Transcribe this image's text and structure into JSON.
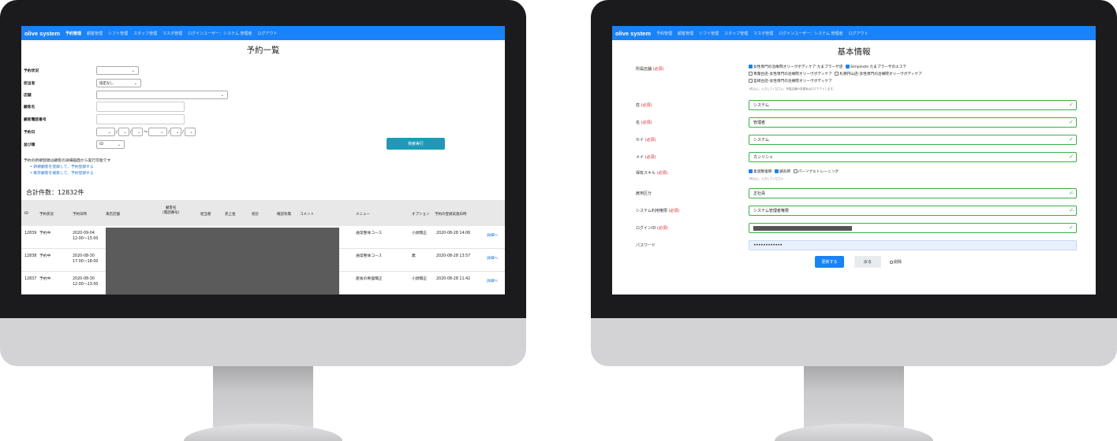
{
  "left": {
    "nav": {
      "brand": "olive system",
      "items": [
        "予約管理",
        "顧客管理",
        "シフト管理",
        "スタッフ管理",
        "マスタ管理",
        "ログインユーザー：システム 管理者",
        "ログアウト"
      ]
    },
    "title": "予約一覧",
    "form": {
      "status_label": "予約状況",
      "status_value": "",
      "staff_label": "担当者",
      "staff_value": "指定なし",
      "store_label": "店舗",
      "store_value": "",
      "customer_label": "顧客名",
      "phone_label": "顧客電話番号",
      "date_label": "予約日",
      "date_sep": "/",
      "date_range": "〜",
      "sort_label": "並び順",
      "sort_value": "ID",
      "search_button": "検索実行"
    },
    "notes": {
      "text": "予約の新規登録は顧客の詳細画面から実行可能です",
      "links": [
        "新規顧客を登録して、予約登録する",
        "既存顧客を検索して、予約登録する"
      ]
    },
    "total": "合計件数：12832件",
    "columns": {
      "id": "ID",
      "status": "予約状況",
      "datetime": "予約日時",
      "store": "来店店舗",
      "customer": "顧客名\n(電話番号)",
      "staff": "担当者",
      "sales": "売上金",
      "first": "初診",
      "confirm": "確認有無",
      "comment": "コメント",
      "menu": "メニュー",
      "option": "オプション",
      "registered": "予約の登録実施日時"
    },
    "rows": [
      {
        "id": "12839",
        "status": "予約中",
        "date": "2020-09-04",
        "time": "12:00〜13:00",
        "menu": "通常整体コース",
        "option": "小顔矯正",
        "registered": "2020-08-28 14:06",
        "detail": "詳細へ"
      },
      {
        "id": "12838",
        "status": "予約中",
        "date": "2020-08-30",
        "time": "17:00〜18:00",
        "menu": "通常整体コース",
        "option": "無",
        "registered": "2020-08-28 13:57",
        "detail": "詳細へ"
      },
      {
        "id": "12837",
        "status": "予約中",
        "date": "2020-08-30",
        "time": "12:00〜13:00",
        "menu": "産後の骨盤矯正",
        "option": "小顔矯正",
        "registered": "2020-08-28 11:42",
        "detail": "詳細へ"
      }
    ]
  },
  "right": {
    "nav": {
      "brand": "olive system",
      "items": [
        "予約管理",
        "顧客管理",
        "シフト管理",
        "スタッフ管理",
        "マスタ管理",
        "ログインユーザー：システム 管理者",
        "ログアウト"
      ]
    },
    "title": "基本情報",
    "required": "(必須)",
    "store_label": "所属店舗",
    "stores": [
      {
        "name": "女性専門の治療院オリーヴボディケア たまプラーザ店",
        "checked": true
      },
      {
        "name": "Simpleste たまプラーザのエステ",
        "checked": true
      },
      {
        "name": "青葉台店-女性専門の治療院オリーヴボディケア",
        "checked": false
      },
      {
        "name": "札幌円山店-女性専門の治療院オリーヴボディケア",
        "checked": false
      },
      {
        "name": "宮崎台店-女性専門の治療院オリーヴボディケア",
        "checked": false
      }
    ],
    "store_hint": "1件以上、入力してください。所属店舗の変更後はログアウトします。",
    "last_label": "姓",
    "last_value": "システム",
    "first_label": "名",
    "first_value": "管理者",
    "last_kana_label": "セイ",
    "last_kana_value": "システム",
    "first_kana_label": "メイ",
    "first_kana_value": "カンリシャ",
    "skill_label": "保有スキル",
    "skills": [
      {
        "name": "柔道整復師",
        "checked": true
      },
      {
        "name": "鍼灸師",
        "checked": true
      },
      {
        "name": "パーソナルトレーニング",
        "checked": false
      }
    ],
    "skill_hint": "1件以上、入力してください",
    "employment_label": "雇用区分",
    "employment_value": "正社員",
    "permission_label": "システム利用権限",
    "permission_value": "システム管理者権限",
    "login_label": "ログインID",
    "password_label": "パスワード",
    "password_value": "••••••••••••",
    "update_button": "更新する",
    "back_button": "戻る",
    "delete_label": "削除"
  }
}
